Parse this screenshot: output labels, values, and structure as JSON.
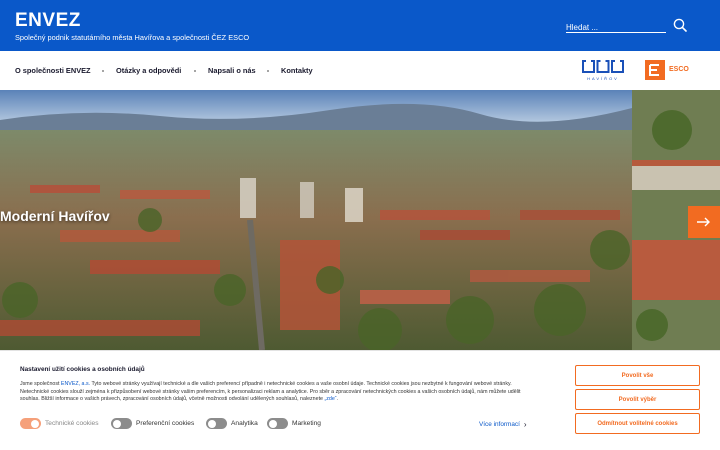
{
  "header": {
    "brand": "ENVEZ",
    "tagline": "Společný podnik statutárního města Havířova a společnosti ČEZ ESCO",
    "search_placeholder": "Hledat ...",
    "search_icon": "search-icon"
  },
  "nav": {
    "items": [
      {
        "label": "O společnosti ENVEZ"
      },
      {
        "label": "Otázky a odpovědi"
      },
      {
        "label": "Napsali o nás"
      },
      {
        "label": "Kontakty"
      }
    ],
    "logos": {
      "havirov_text": "HAVÍŘOV",
      "esco_text": "ESCO"
    }
  },
  "hero": {
    "caption": "Moderní Havířov",
    "next_icon": "arrow-right-icon"
  },
  "cookie": {
    "title": "Nastavení užití cookies a osobních údajů",
    "text_before_link": "Jsme společnost ",
    "company_link": "ENVEZ, a.s.",
    "text_after_link": " Tyto webové stránky využívají technické a dle vašich preferencí případně i netechnické cookies a vaše osobní údaje. Technické cookies jsou nezbytné k fungování webové stránky. Netechnické cookies slouží zejména k přizpůsobení webové stránky vašim preferencím, k personalizaci reklam a analytice. Pro sběr a zpracování netechnických cookies a vašich osobních údajů, nám můžete udělit souhlas. Bližší informace o vašich právech, zpracování osobních údajů, včetně možnosti odvolání udělených souhlasů, naleznete ",
    "here_link": "„zde“",
    "text_end": ".",
    "toggles": [
      {
        "label": "Technické cookies",
        "on": true,
        "disabled": true
      },
      {
        "label": "Preferenční cookies",
        "on": false,
        "disabled": false
      },
      {
        "label": "Analytika",
        "on": false,
        "disabled": false
      },
      {
        "label": "Marketing",
        "on": false,
        "disabled": false
      }
    ],
    "more_link": "Více informací",
    "buttons": {
      "allow_all": "Povolit vše",
      "allow_selected": "Povolit výběr",
      "reject_optional": "Odmítnout volitelné cookies"
    }
  },
  "colors": {
    "brand_blue": "#0a58c9",
    "accent_orange": "#f26b21"
  }
}
